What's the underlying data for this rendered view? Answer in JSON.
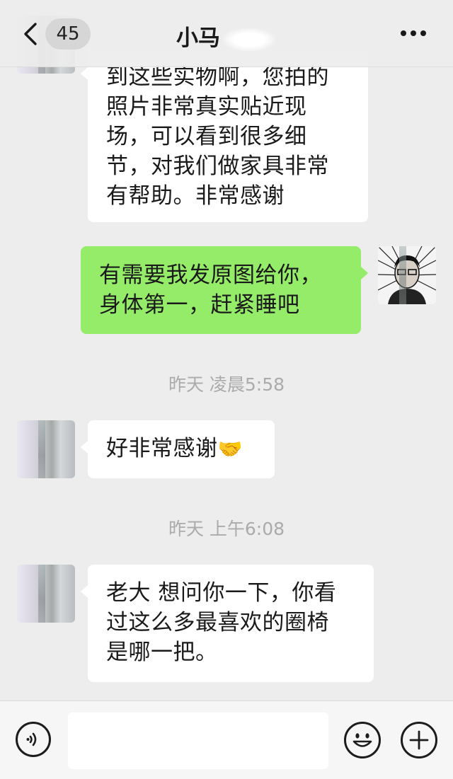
{
  "header": {
    "back_label": "<",
    "unread_count": "45",
    "contact_name": "小马",
    "more_label": "more"
  },
  "messages": [
    {
      "type": "incoming",
      "lines": [
        "到这些实物啊，您拍的",
        "照片非常真实贴近现",
        "场，可以看到很多细",
        "节，对我们做家具非常",
        "有帮助。非常感谢"
      ]
    },
    {
      "type": "outgoing",
      "lines": [
        "有需要我发原图给你，",
        "身体第一，赶紧睡吧"
      ]
    },
    {
      "type": "timestamp",
      "text": "昨天 凌晨5:58"
    },
    {
      "type": "incoming",
      "text": "好非常感谢",
      "emoji": "🤝"
    },
    {
      "type": "timestamp",
      "text": "昨天 上午6:08"
    },
    {
      "type": "incoming",
      "lines": [
        "老大 想问你一下，你看",
        "过这么多最喜欢的圈椅",
        "是哪一把。"
      ]
    }
  ],
  "composer": {
    "input_value": "",
    "voice_icon": "voice-icon",
    "emoji_icon": "emoji-icon",
    "plus_icon": "plus-icon"
  },
  "colors": {
    "background": "#ededed",
    "outgoing_bubble": "#95ec69",
    "incoming_bubble": "#ffffff",
    "timestamp_text": "#ababab"
  }
}
